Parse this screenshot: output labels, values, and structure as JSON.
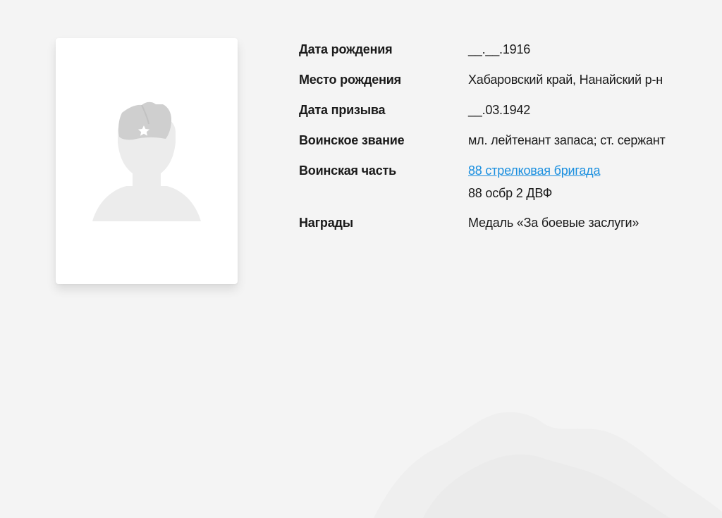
{
  "person": {
    "photo_alt": "",
    "fields": [
      {
        "label": "Дата рождения",
        "value": "__.__.1916"
      },
      {
        "label": "Место рождения",
        "value": "Хабаровский край, Нанайский р-н"
      },
      {
        "label": "Дата призыва",
        "value": "__.03.1942"
      },
      {
        "label": "Воинское звание",
        "value": "мл. лейтенант запаса; ст. сержант"
      },
      {
        "label": "Воинская часть",
        "link": "88 стрелковая бригада",
        "value": "88 осбр 2 ДВФ"
      },
      {
        "label": "Награды",
        "value": "Медаль «За боевые заслуги»"
      }
    ]
  },
  "colors": {
    "background": "#f4f4f4",
    "card": "#ffffff",
    "link": "#1a8fdf",
    "silhouette": "#ececec",
    "cap": "#cfcfcf"
  },
  "icons": {
    "photo_placeholder": "soldier-silhouette-icon",
    "cap_star": "star-icon"
  }
}
